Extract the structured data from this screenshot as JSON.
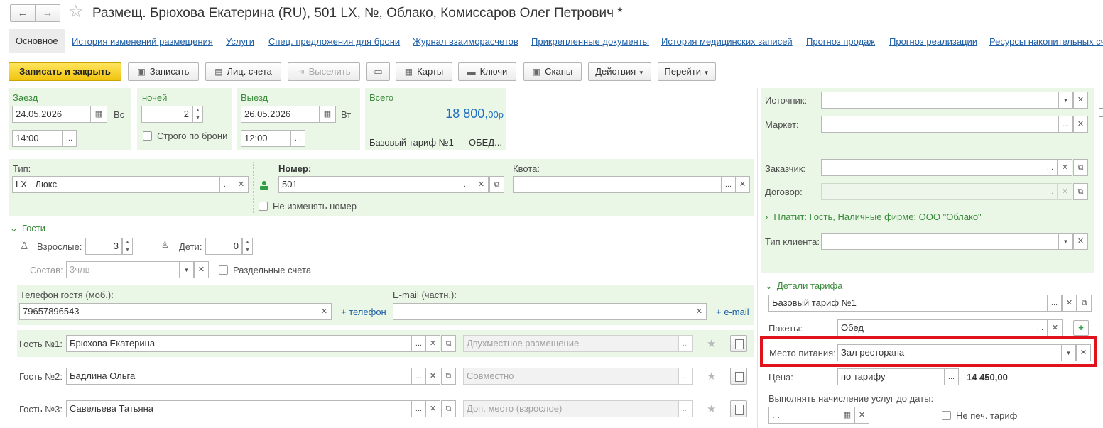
{
  "window": {
    "title": "Размещ. Брюхова Екатерина (RU), 501 LX, №, Облако, Комиссаров Олег Петрович *",
    "back": "←",
    "forward": "→",
    "star": "☆"
  },
  "tabs": [
    "Основное",
    "История изменений размещения",
    "Услуги",
    "Спец. предложения для брони",
    "Журнал взаиморасчетов",
    "Прикрепленные документы",
    "История медицинских записей",
    "Прогноз продаж",
    "Прогноз реализации",
    "Ресурсы накопительных сч"
  ],
  "toolbar": {
    "save_close": "Записать и закрыть",
    "save": "Записать",
    "accounts": "Лиц. счета",
    "select": "Выселить",
    "cards": "Карты",
    "keys": "Ключи",
    "scans": "Сканы",
    "actions": "Действия",
    "goto": "Перейти"
  },
  "stay": {
    "checkin_label": "Заезд",
    "checkin_date": "24.05.2026",
    "checkin_day": "Вс",
    "checkin_time": "14:00",
    "nights_label": "ночей",
    "nights": "2",
    "strict_label": "Строго по брони",
    "checkout_label": "Выезд",
    "checkout_date": "26.05.2026",
    "checkout_day": "Вт",
    "checkout_time": "12:00",
    "total_label": "Всего",
    "total_main": "18 800,",
    "total_cents": "00р",
    "tariff": "Базовый тариф №1",
    "meal_short": "ОБЕД..."
  },
  "room": {
    "type_label": "Тип:",
    "type_value": "LX - Люкс",
    "number_label": "Номер:",
    "number_value": "501",
    "keep_number": "Не изменять номер",
    "quota_label": "Квота:"
  },
  "guests": {
    "section": "Гости",
    "adults_label": "Взрослые:",
    "adults": "3",
    "children_label": "Дети:",
    "children": "0",
    "composition_label": "Состав:",
    "composition_ph": "3члв",
    "separate_accounts": "Раздельные счета",
    "phone_label": "Телефон гостя (моб.):",
    "phone": "79657896543",
    "add_phone": "+ телефон",
    "email_label": "E-mail (частн.):",
    "add_email": "+ e-mail",
    "list": [
      {
        "label": "Гость №1:",
        "name": "Брюхова Екатерина",
        "placement": "Двухместное размещение"
      },
      {
        "label": "Гость №2:",
        "name": "Бадлина Ольга",
        "placement": "Совместно"
      },
      {
        "label": "Гость №3:",
        "name": "Савельева Татьяна",
        "placement": "Доп. место (взрослое)"
      }
    ]
  },
  "right": {
    "source_label": "Источник:",
    "market_label": "Маркет:",
    "customer_label": "Заказчик:",
    "contract_label": "Договор:",
    "payer": "Платит: Гость, Наличные фирме: ООО \"Облако\"",
    "client_type_label": "Тип клиента:",
    "tariff_section": "Детали тарифа",
    "tariff_value": "Базовый тариф №1",
    "packages_label": "Пакеты:",
    "packages_value": "Обед",
    "meal_place_label": "Место питания:",
    "meal_place_value": "Зал ресторана",
    "price_label": "Цена:",
    "price_mode": "по тарифу",
    "price_value": "14 450,00",
    "accrue_label": "Выполнять начисление услуг до даты:",
    "accrue_ph": " .  .",
    "no_print_tariff": "Не печ. тариф"
  },
  "colors": {
    "highlight": "#e0121b",
    "panel": "#eaf7e7",
    "primary": "#f5d11f",
    "link": "#1f5fa6"
  }
}
